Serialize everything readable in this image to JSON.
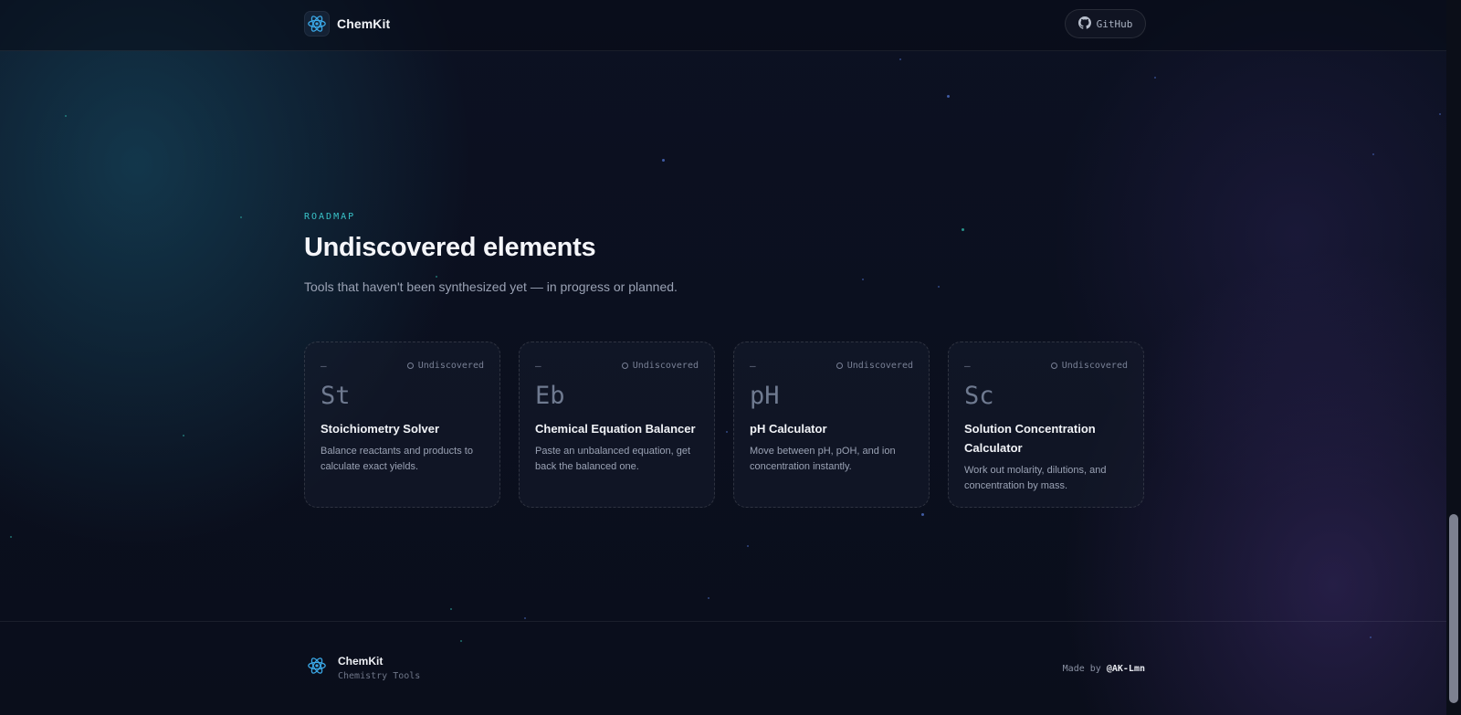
{
  "header": {
    "brand_name": "ChemKit",
    "logo_icon": "atom-icon",
    "github_label": "GitHub",
    "github_icon": "github-icon"
  },
  "roadmap": {
    "eyebrow": "ROADMAP",
    "title": "Undiscovered elements",
    "subtitle": "Tools that haven't been synthesized yet — in progress or planned."
  },
  "cards": [
    {
      "number": "—",
      "status": "Undiscovered",
      "symbol": "St",
      "title": "Stoichiometry Solver",
      "description": "Balance reactants and products to calculate exact yields."
    },
    {
      "number": "—",
      "status": "Undiscovered",
      "symbol": "Eb",
      "title": "Chemical Equation Balancer",
      "description": "Paste an unbalanced equation, get back the balanced one."
    },
    {
      "number": "—",
      "status": "Undiscovered",
      "symbol": "pH",
      "title": "pH Calculator",
      "description": "Move between pH, pOH, and ion concentration instantly."
    },
    {
      "number": "—",
      "status": "Undiscovered",
      "symbol": "Sc",
      "title": "Solution Concentration Calculator",
      "description": "Work out molarity, dilutions, and concentration by mass."
    }
  ],
  "footer": {
    "brand_name": "ChemKit",
    "tagline": "Chemistry Tools",
    "made_by_prefix": "Made by",
    "author": "@AK-Lmn"
  },
  "colors": {
    "accent": "#39c3c9",
    "atom": "#3aa7e6",
    "background": "#0b0f1c"
  }
}
